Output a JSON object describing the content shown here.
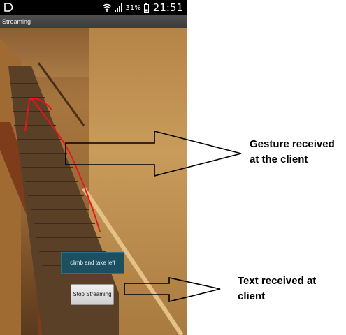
{
  "statusbar": {
    "battery_percent": "31%",
    "time": "21:51",
    "icons": [
      "app-notification-icon",
      "wifi-icon",
      "signal-icon",
      "battery-icon"
    ]
  },
  "app": {
    "title": "Streaming"
  },
  "stream": {
    "received_text": "climb and take left",
    "stop_button_label": "Stop Streaming"
  },
  "annotations": {
    "gesture_line1": "Gesture received",
    "gesture_line2": "at the client",
    "text_line1": "Text received at",
    "text_line2": "client"
  },
  "colors": {
    "gesture_stroke": "#e8141e",
    "received_text_bg": "#1c4f60"
  }
}
